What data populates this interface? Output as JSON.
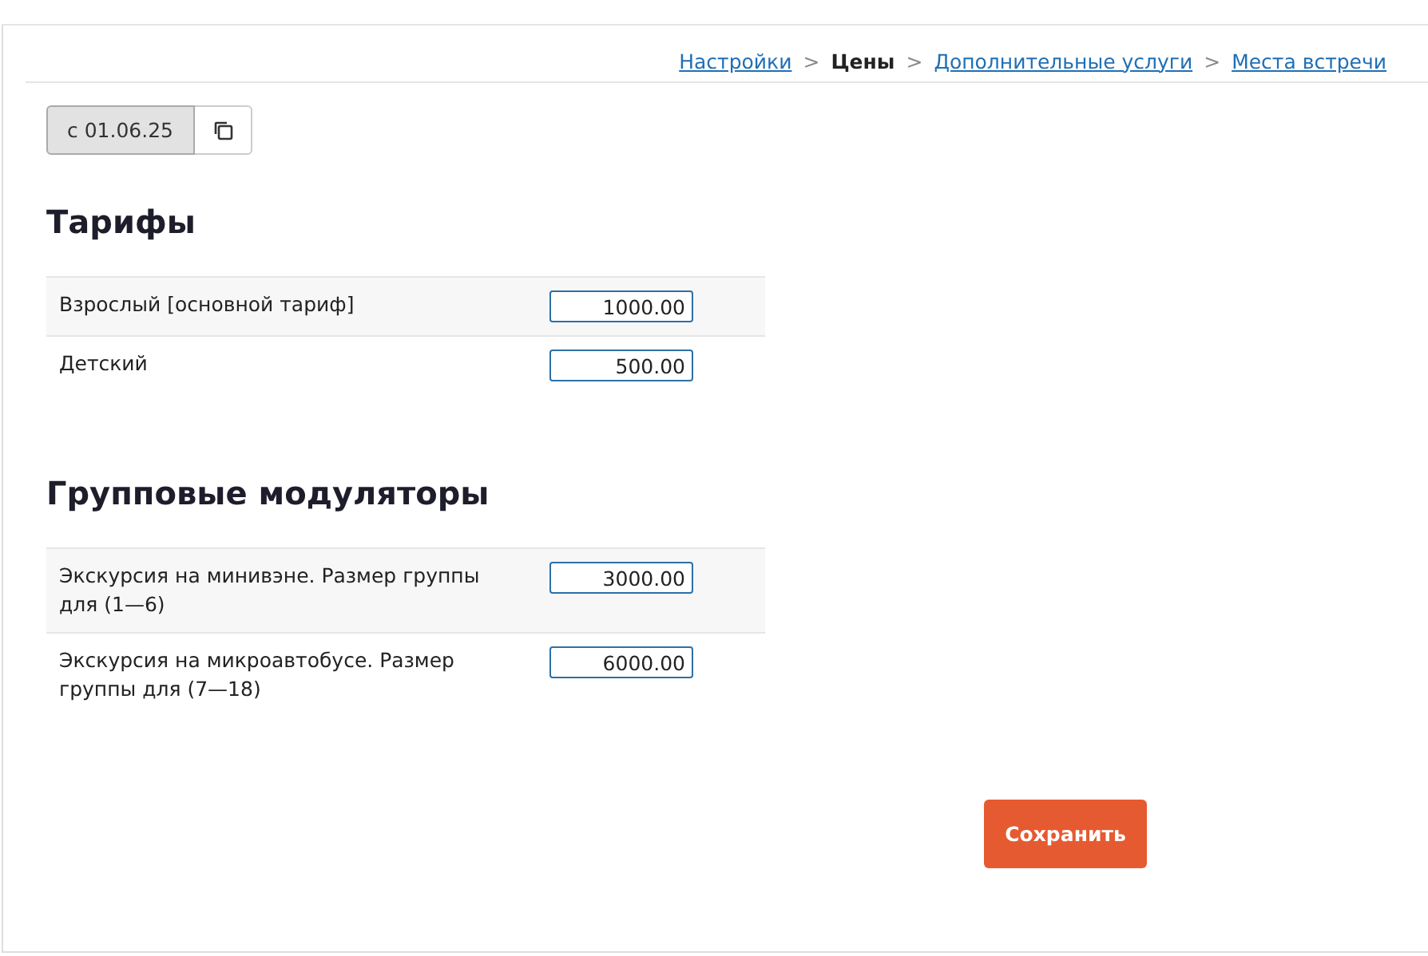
{
  "breadcrumbs": [
    {
      "kind": "link",
      "label": "Настройки"
    },
    {
      "kind": "separator",
      "label": ">"
    },
    {
      "kind": "current",
      "label": "Цены"
    },
    {
      "kind": "separator",
      "label": ">"
    },
    {
      "kind": "link",
      "label": "Дополнительные услуги"
    },
    {
      "kind": "separator",
      "label": ">"
    },
    {
      "kind": "link",
      "label": "Места встречи"
    }
  ],
  "periods": [
    {
      "label": "с 01.06.25",
      "selected": true
    }
  ],
  "sections": [
    {
      "title": "Тарифы",
      "rows": [
        {
          "label": "Взрослый [основной тариф]",
          "value": "1000.00"
        },
        {
          "label": "Детский",
          "value": "500.00"
        }
      ]
    },
    {
      "title": "Групповые модуляторы",
      "rows": [
        {
          "label": "Экскурсия на минивэне. Размер группы для (1—6)",
          "value": "3000.00"
        },
        {
          "label": "Экскурсия на микроавтобусе. Размер группы для (7—18)",
          "value": "6000.00"
        }
      ]
    }
  ],
  "save_button": "Сохранить"
}
